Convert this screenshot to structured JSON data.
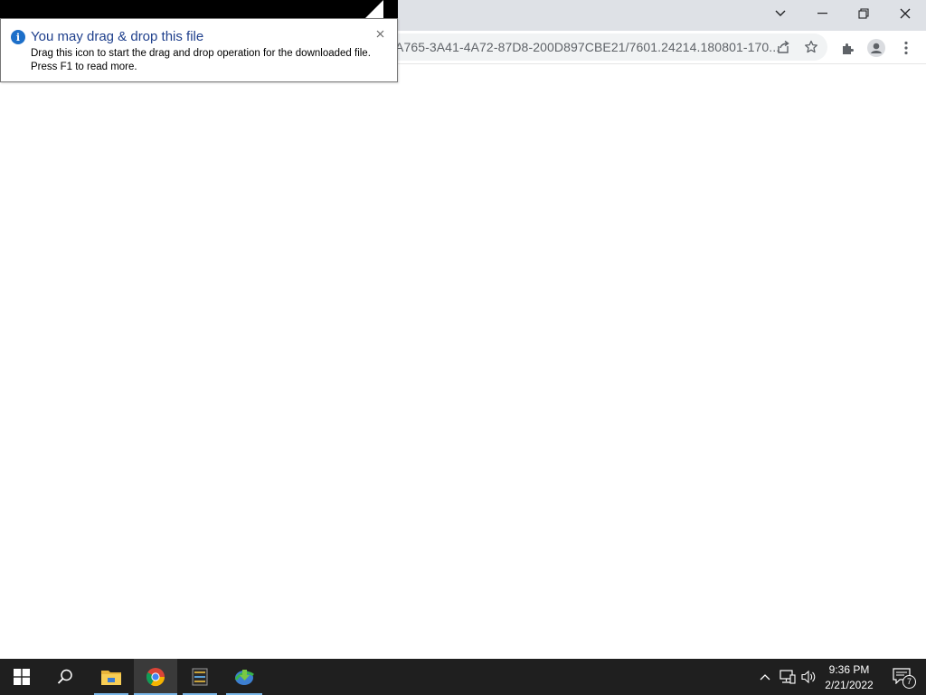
{
  "browser": {
    "url": "A765-3A41-4A72-87D8-200D897CBE21/7601.24214.180801-170...",
    "window_controls": {
      "tab_search_icon": "chevron-down-icon",
      "minimize_icon": "minimize-icon",
      "restore_icon": "restore-icon",
      "close_icon": "close-icon"
    },
    "toolbar_icons": [
      "share-icon",
      "star-icon",
      "extensions-icon",
      "profile-icon",
      "kebab-menu-icon"
    ]
  },
  "balloon": {
    "title": "You may drag & drop this file",
    "line1": "Drag this icon to start the drag and drop operation for the downloaded file.",
    "line2": "Press F1 to read more.",
    "close_label": "x"
  },
  "taskbar": {
    "apps": [
      "start-icon",
      "search-icon",
      "file-explorer-icon",
      "chrome-icon",
      "app-icon",
      "download-manager-icon"
    ],
    "tray": {
      "time": "9:36 PM",
      "date": "2/21/2022",
      "notification_count": "7"
    }
  },
  "colors": {
    "tab_strip": "#dee1e6",
    "omnibox": "#f1f3f4",
    "taskbar": "#1f1f1f",
    "balloon_title": "#1e3f8c",
    "info_blue": "#1c6fc9"
  }
}
